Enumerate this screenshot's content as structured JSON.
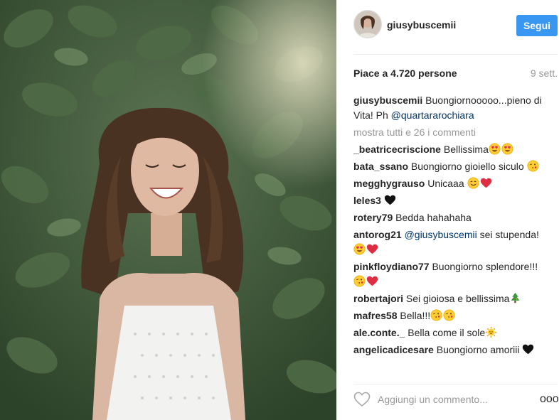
{
  "post": {
    "username": "giusybuscemii",
    "follow_label": "Segui",
    "likes": "Piace a 4.720 persone",
    "date": "9 sett."
  },
  "caption": {
    "user": "giusybuscemii",
    "text": " Buongiornooooo...pieno di Vita! Ph ",
    "mention": "@quartararochiara"
  },
  "view_all": "mostra tutti e 26 i commenti",
  "comments": [
    {
      "user": "_beatricecriscione",
      "text": " Bellissima",
      "emoji": [
        "heart-eyes",
        "heart-eyes"
      ]
    },
    {
      "user": "bata_ssano",
      "text": " Buongiorno gioiello siculo ",
      "emoji": [
        "kiss"
      ]
    },
    {
      "user": "megghygrauso",
      "text": " Unicaaa ",
      "emoji": [
        "smile",
        "red-heart"
      ]
    },
    {
      "user": "leles3",
      "text": " ",
      "emoji": [
        "black-heart"
      ]
    },
    {
      "user": "rotery79",
      "text": " Bedda hahahaha",
      "emoji": []
    },
    {
      "user": "antorog21",
      "mention": "@giusybuscemii",
      "text": " sei stupenda! ",
      "emoji": [
        "heart-eyes",
        "red-heart"
      ]
    },
    {
      "user": "pinkfloydiano77",
      "text": " Buongiorno splendore!!! ",
      "emoji": [
        "kiss",
        "red-heart"
      ]
    },
    {
      "user": "robertajori",
      "text": " Sei gioiosa e bellissima",
      "emoji": [
        "tree"
      ]
    },
    {
      "user": "mafres58",
      "text": " Bella!!!",
      "emoji": [
        "kiss",
        "kiss"
      ]
    },
    {
      "user": "ale.conte._",
      "text": " Bella come il sole",
      "emoji": [
        "sun"
      ]
    },
    {
      "user": "angelicadicesare",
      "text": " Buongiorno amoriii ",
      "emoji": [
        "black-heart"
      ]
    }
  ],
  "actions": {
    "like_icon": "heart-outline-icon",
    "comment_placeholder": "Aggiungi un commento...",
    "more_label": "ooo"
  },
  "colors": {
    "follow_button": "#3897f0",
    "link": "#003569",
    "muted": "#999999"
  }
}
